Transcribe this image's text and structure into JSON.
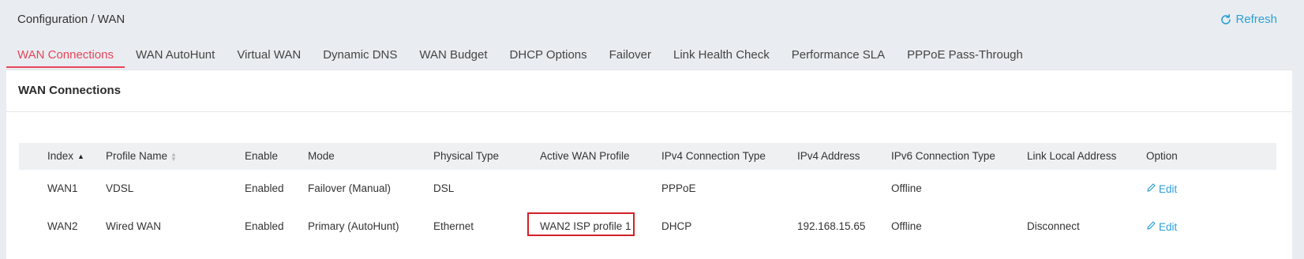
{
  "header": {
    "breadcrumb": "Configuration / WAN",
    "refresh_label": "Refresh",
    "refresh_icon": "refresh-icon"
  },
  "tabs": [
    {
      "label": "WAN Connections",
      "active": true
    },
    {
      "label": "WAN AutoHunt"
    },
    {
      "label": "Virtual WAN"
    },
    {
      "label": "Dynamic DNS"
    },
    {
      "label": "WAN Budget"
    },
    {
      "label": "DHCP Options"
    },
    {
      "label": "Failover"
    },
    {
      "label": "Link Health Check"
    },
    {
      "label": "Performance SLA"
    },
    {
      "label": "PPPoE Pass-Through"
    }
  ],
  "card": {
    "title": "WAN Connections"
  },
  "table": {
    "columns": [
      "Index",
      "Profile Name",
      "Enable",
      "Mode",
      "Physical Type",
      "Active WAN Profile",
      "IPv4 Connection Type",
      "IPv4 Address",
      "IPv6 Connection Type",
      "Link Local Address",
      "Option"
    ],
    "rows": [
      {
        "index": "WAN1",
        "profile_name": "VDSL",
        "enable": "Enabled",
        "mode": "Failover (Manual)",
        "physical_type": "DSL",
        "active_wan_profile": "",
        "ipv4_conn_type": "PPPoE",
        "ipv4_address": "",
        "ipv6_conn_type": "Offline",
        "link_local": "",
        "option": "Edit"
      },
      {
        "index": "WAN2",
        "profile_name": "Wired WAN",
        "enable": "Enabled",
        "mode": "Primary (AutoHunt)",
        "physical_type": "Ethernet",
        "active_wan_profile": "WAN2 ISP profile 1",
        "ipv4_conn_type": "DHCP",
        "ipv4_address": "192.168.15.65",
        "ipv6_conn_type": "Offline",
        "link_local": "Disconnect",
        "option": "Edit"
      }
    ]
  },
  "colors": {
    "accent_red": "#e8445a",
    "link_blue": "#2d9fd8",
    "highlight_border": "#d32027"
  }
}
